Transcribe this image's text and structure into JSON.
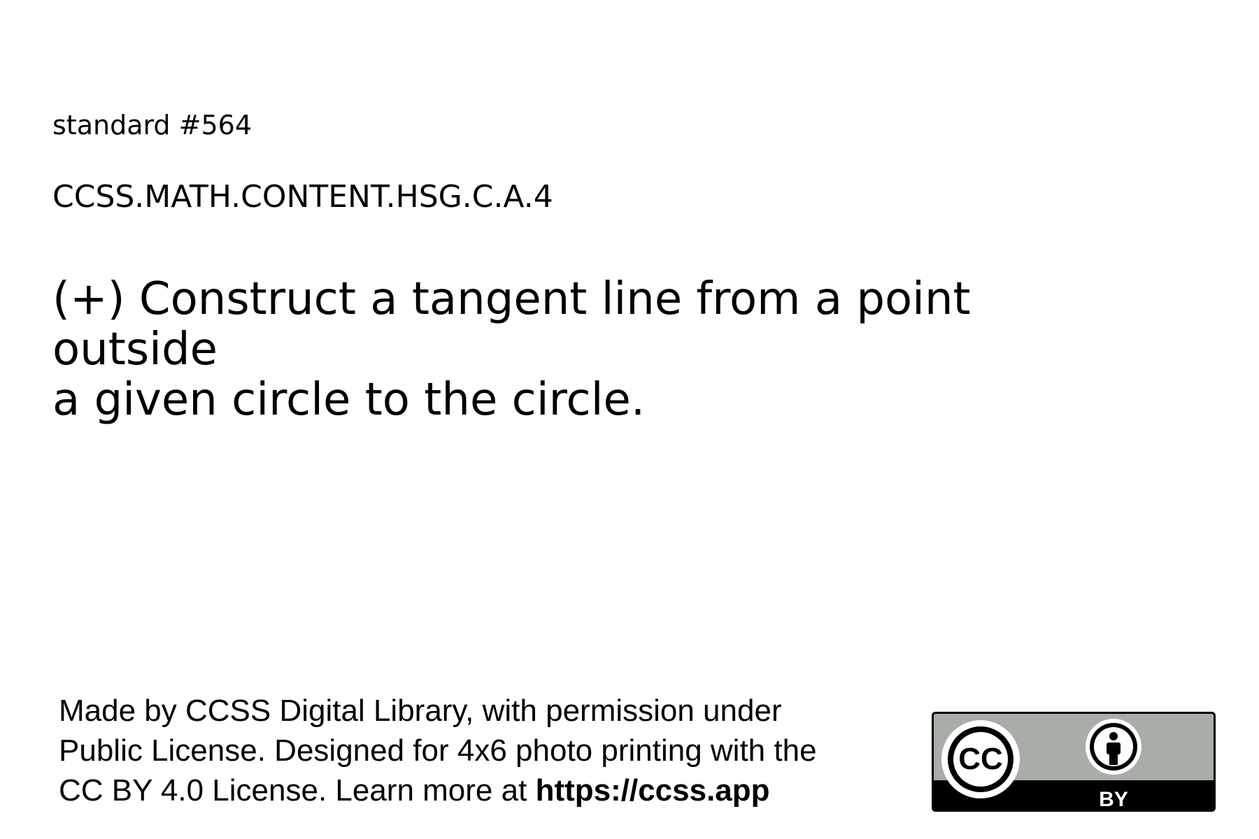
{
  "card": {
    "standard_number": "standard #564",
    "standard_code": "CCSS.MATH.CONTENT.HSG.C.A.4",
    "standard_text_line1": "(+) Construct a tangent line from a point outside",
    "standard_text_line2": "a given circle to the circle."
  },
  "footer": {
    "line1": "Made by CCSS Digital Library, with permission under",
    "line2": "Public License. Designed for 4x6 photo printing with the",
    "line3_prefix": "CC BY 4.0 License. Learn more at ",
    "link": "https://ccss.app"
  },
  "license_badge": {
    "cc_text": "CC",
    "by_text": "BY",
    "icons": [
      "cc-icon",
      "attribution-person-icon"
    ],
    "colors": {
      "badge_gray": "#a9ada8",
      "badge_black": "#000000",
      "badge_white": "#ffffff"
    }
  }
}
